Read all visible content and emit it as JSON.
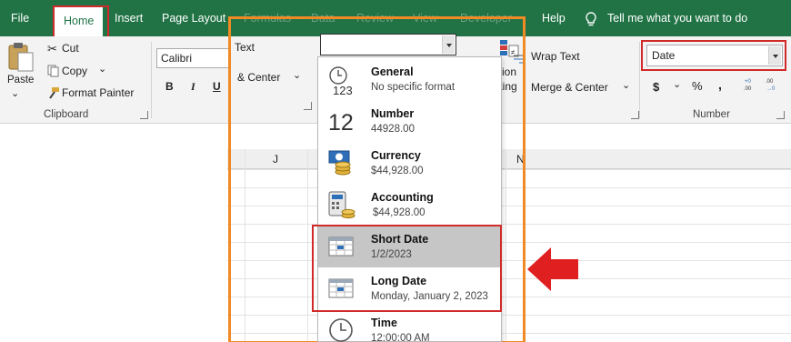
{
  "tabs": {
    "file": "File",
    "home": "Home",
    "insert": "Insert",
    "page_layout": "Page Layout",
    "formulas": "Formulas",
    "data": "Data",
    "review": "Review",
    "view": "View",
    "developer": "Developer",
    "help": "Help",
    "tell_me": "Tell me what you want to do"
  },
  "clipboard": {
    "paste": "Paste",
    "cut": "Cut",
    "copy": "Copy",
    "copy_chevron": "⌄",
    "format_painter": "Format Painter",
    "group_label": "Clipboard"
  },
  "font": {
    "name": "Calibri",
    "bold": "B",
    "italic": "I",
    "underline": "U"
  },
  "alignment": {
    "text_partial": "Text",
    "center_partial": "& Center",
    "chevron": "⌄",
    "wrap_text": "Wrap Text",
    "merge_center": "Merge & Center",
    "conditional_partial_1": "ition",
    "conditional_partial_2": "tting"
  },
  "number": {
    "format_value": "Date",
    "currency_symbol": "$",
    "chevron": "⌄",
    "percent": "%",
    "comma": ",",
    "group_label": "Number"
  },
  "columns": {
    "j": "J",
    "n_partial": "N"
  },
  "format_dropdown": {
    "current_value": "",
    "items": [
      {
        "name": "General",
        "example": "No specific format",
        "icon": "clock-123-icon"
      },
      {
        "name": "Number",
        "example": "44928.00",
        "icon": "number-12-icon"
      },
      {
        "name": "Currency",
        "example": "$44,928.00",
        "icon": "currency-icon"
      },
      {
        "name": "Accounting",
        "example": "$44,928.00",
        "icon": "accounting-icon"
      },
      {
        "name": "Short Date",
        "example": "1/2/2023",
        "icon": "short-date-calendar-icon"
      },
      {
        "name": "Long Date",
        "example": "Monday, January 2, 2023",
        "icon": "long-date-calendar-icon"
      },
      {
        "name": "Time",
        "example": "12:00:00 AM",
        "icon": "clock-icon"
      }
    ]
  },
  "colors": {
    "tab_bar": "#217346",
    "highlight_red": "#d12a2a",
    "panel_orange": "#f08a24",
    "selected_row": "#c6c6c6"
  }
}
